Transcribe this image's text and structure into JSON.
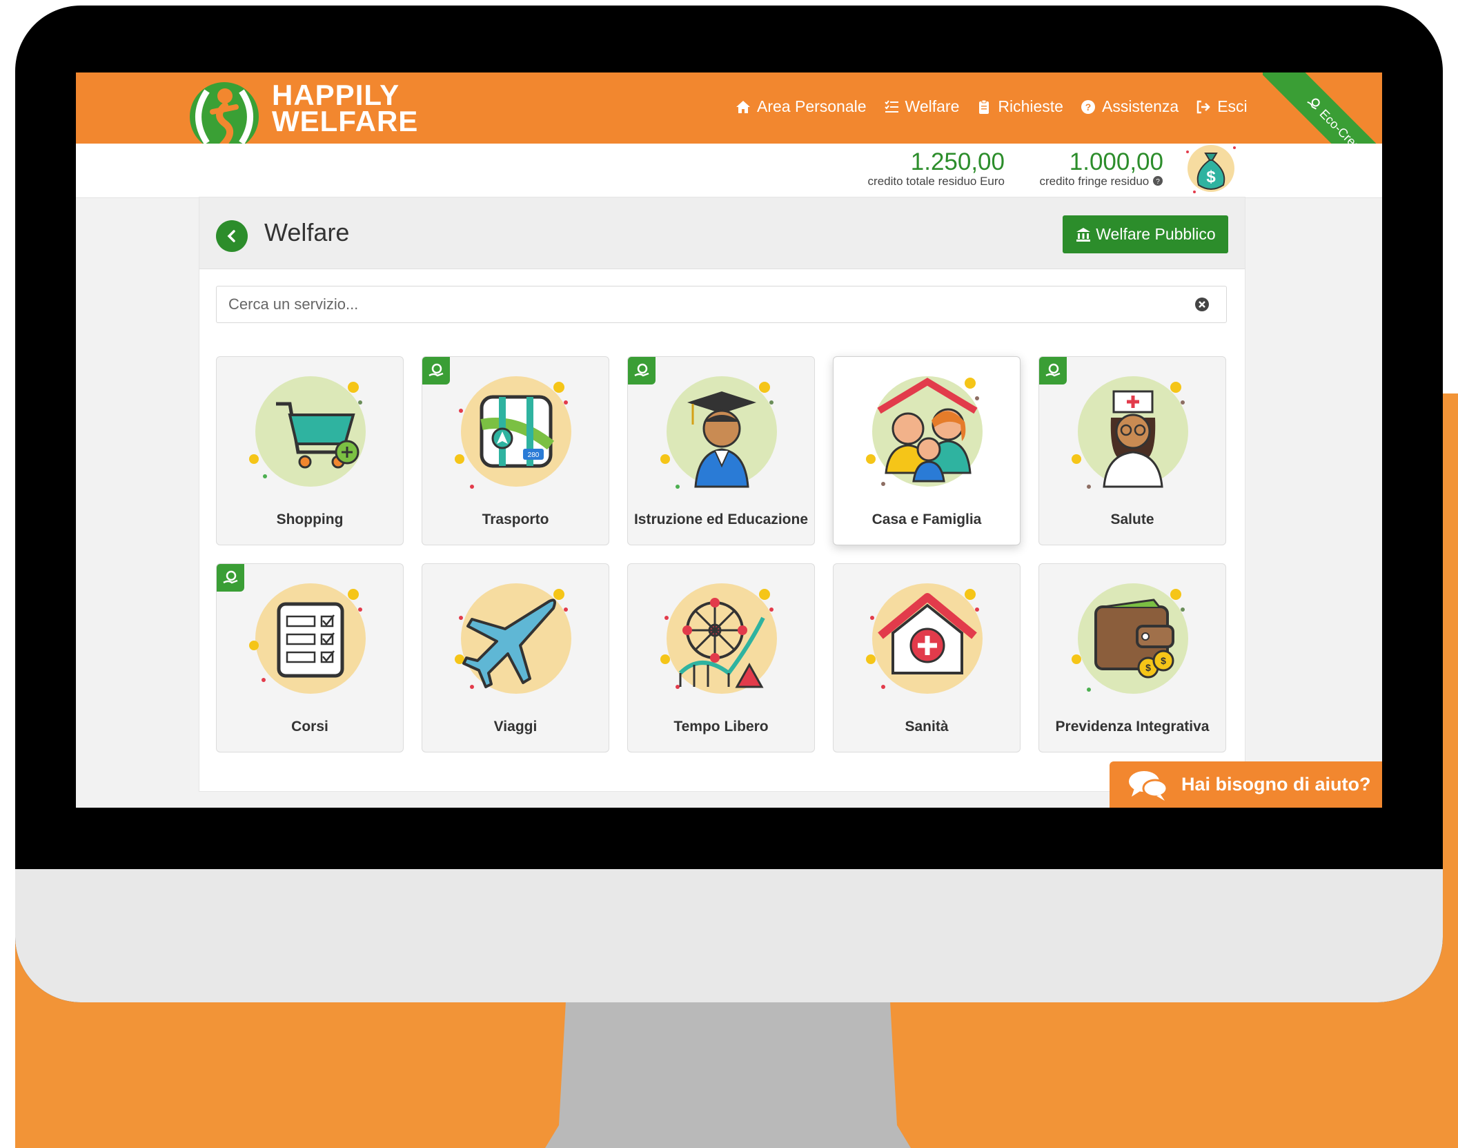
{
  "logo": {
    "line1": "HAPPILY",
    "line2": "WELFARE"
  },
  "nav": [
    {
      "label": "Area Personale",
      "icon": "home-icon"
    },
    {
      "label": "Welfare",
      "icon": "list-icon"
    },
    {
      "label": "Richieste",
      "icon": "clipboard-icon"
    },
    {
      "label": "Assistenza",
      "icon": "question-circle-icon"
    },
    {
      "label": "Esci",
      "icon": "sign-out-icon"
    }
  ],
  "eco_ribbon": {
    "label": "Eco-Credito"
  },
  "credits": {
    "total": {
      "amount": "1.250,00",
      "label": "credito totale residuo Euro"
    },
    "fringe": {
      "amount": "1.000,00",
      "label": "credito fringe residuo"
    }
  },
  "page": {
    "title": "Welfare",
    "public_button": "Welfare Pubblico"
  },
  "search": {
    "placeholder": "Cerca un servizio..."
  },
  "tiles": [
    {
      "label": "Shopping",
      "eco": false,
      "icon": "shopping-cart-icon"
    },
    {
      "label": "Trasporto",
      "eco": true,
      "icon": "map-icon"
    },
    {
      "label": "Istruzione ed Educazione",
      "eco": true,
      "icon": "graduate-icon"
    },
    {
      "label": "Casa e Famiglia",
      "eco": false,
      "icon": "family-icon"
    },
    {
      "label": "Salute",
      "eco": true,
      "icon": "nurse-icon"
    },
    {
      "label": "Corsi",
      "eco": true,
      "icon": "checklist-icon"
    },
    {
      "label": "Viaggi",
      "eco": false,
      "icon": "airplane-icon"
    },
    {
      "label": "Tempo Libero",
      "eco": false,
      "icon": "amusement-park-icon"
    },
    {
      "label": "Sanità",
      "eco": false,
      "icon": "hospital-icon"
    },
    {
      "label": "Previdenza Integrativa",
      "eco": false,
      "icon": "wallet-icon"
    }
  ],
  "help": {
    "label": "Hai bisogno di aiuto?"
  },
  "colors": {
    "orange": "#f2872f",
    "green": "#2c8d2b",
    "eco_green": "#3a9e35"
  }
}
